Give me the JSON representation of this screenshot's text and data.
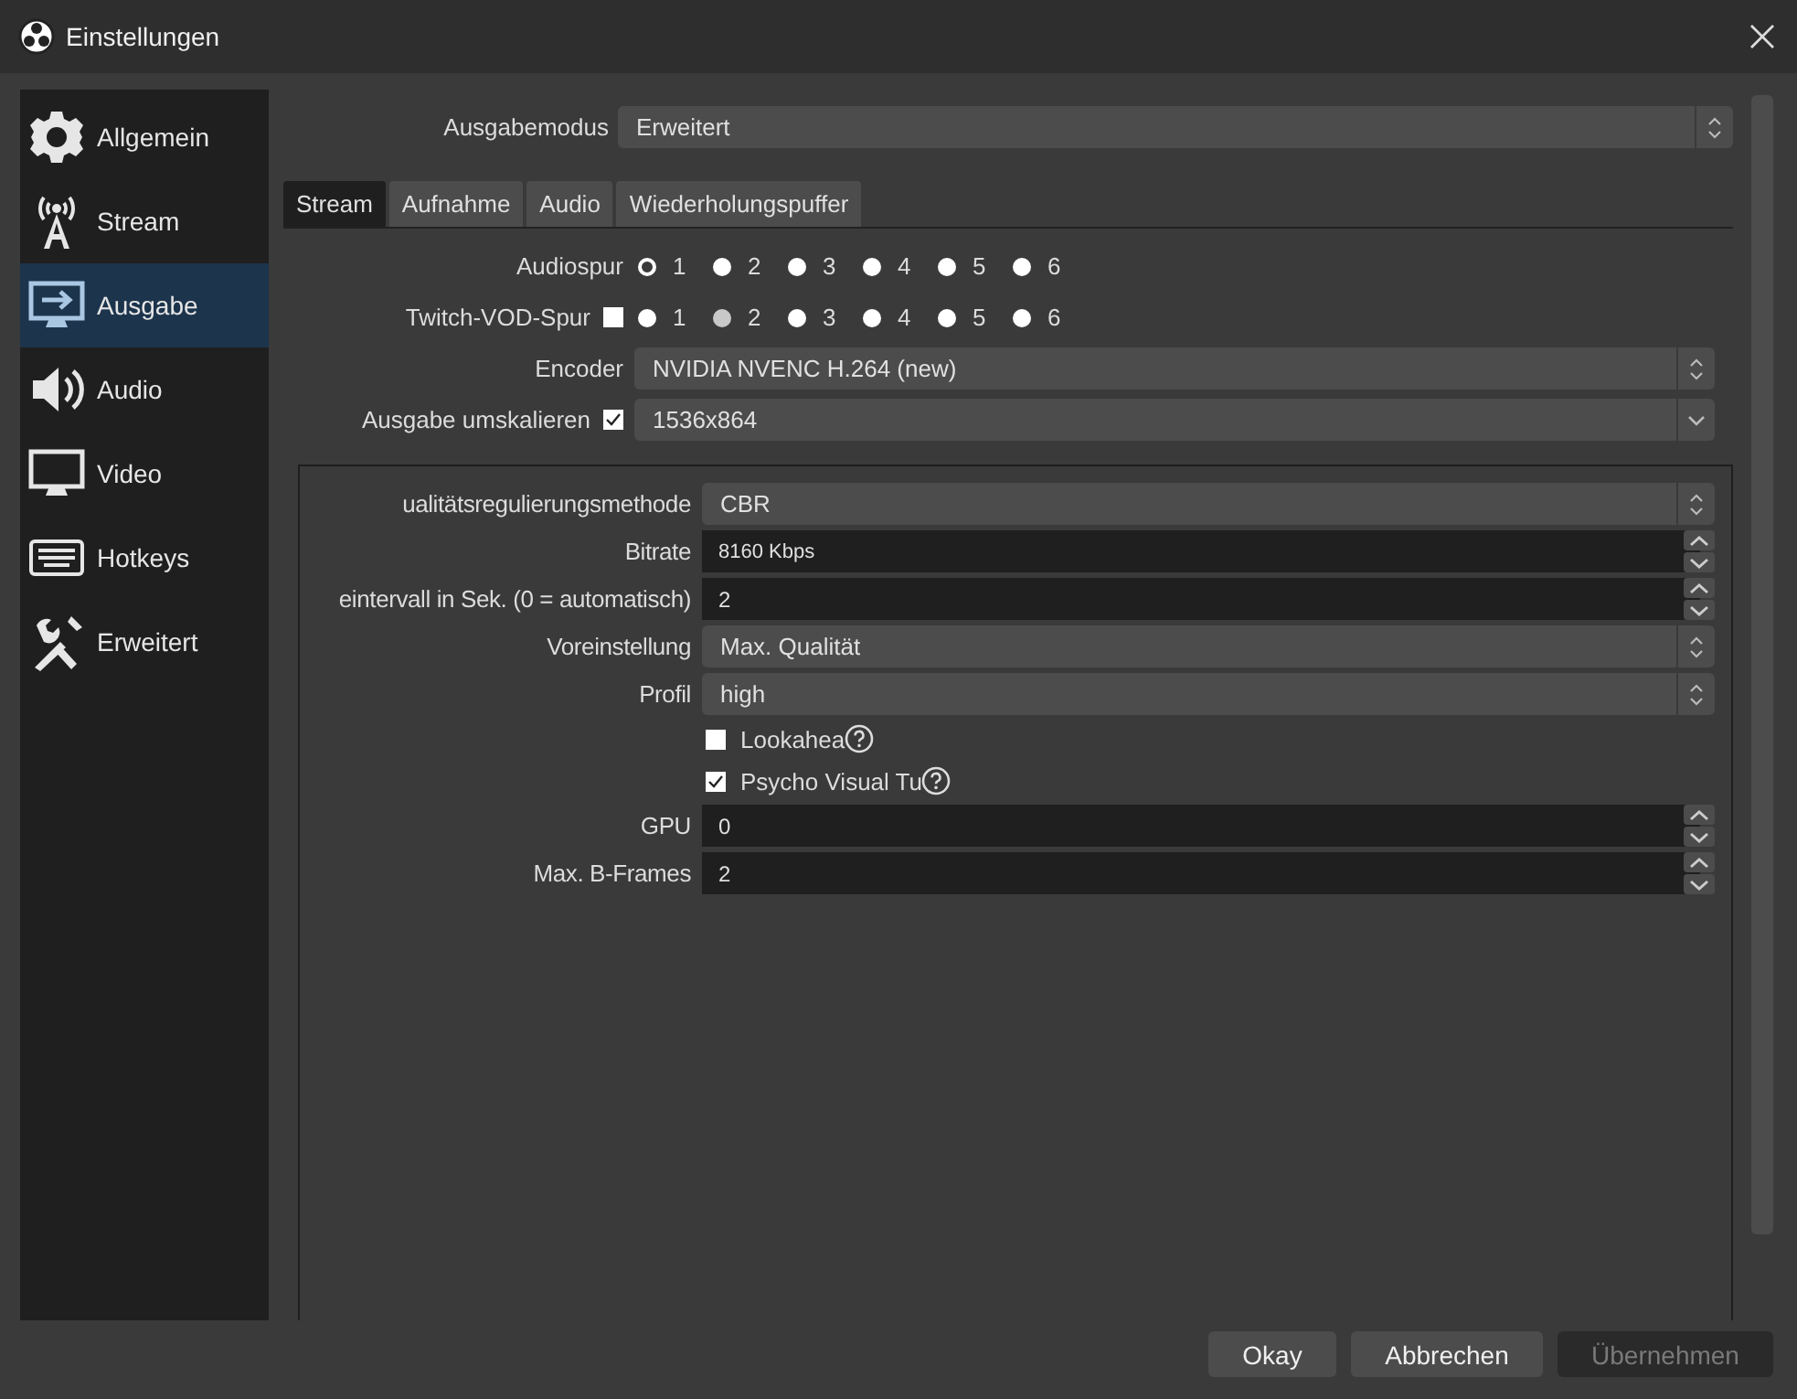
{
  "window": {
    "title": "Einstellungen"
  },
  "sidebar": {
    "items": [
      {
        "label": "Allgemein",
        "kind": "gear",
        "selected": false
      },
      {
        "label": "Stream",
        "kind": "antenna",
        "selected": false
      },
      {
        "label": "Ausgabe",
        "kind": "output",
        "selected": true
      },
      {
        "label": "Audio",
        "kind": "speaker",
        "selected": false
      },
      {
        "label": "Video",
        "kind": "monitor",
        "selected": false
      },
      {
        "label": "Hotkeys",
        "kind": "keyboard",
        "selected": false
      },
      {
        "label": "Erweitert",
        "kind": "tools",
        "selected": false
      }
    ]
  },
  "output_mode": {
    "label": "Ausgabemodus",
    "value": "Erweitert"
  },
  "tabs": [
    {
      "label": "Stream",
      "selected": true
    },
    {
      "label": "Aufnahme",
      "selected": false
    },
    {
      "label": "Audio",
      "selected": false
    },
    {
      "label": "Wiederholungspuffer",
      "selected": false
    }
  ],
  "rows": [
    {
      "kind": "radios",
      "label": "Audiospur",
      "options": [
        {
          "label": "1",
          "selected": true
        },
        {
          "label": "2",
          "selected": false
        },
        {
          "label": "3",
          "selected": false
        },
        {
          "label": "4",
          "selected": false
        },
        {
          "label": "5",
          "selected": false
        },
        {
          "label": "6",
          "selected": false
        }
      ]
    },
    {
      "kind": "check_radios",
      "label": "Twitch-VOD-Spur",
      "checked": false,
      "options": [
        {
          "label": "1",
          "selected": false
        },
        {
          "label": "2",
          "selected": true
        },
        {
          "label": "3",
          "selected": false
        },
        {
          "label": "4",
          "selected": false
        },
        {
          "label": "5",
          "selected": false
        },
        {
          "label": "6",
          "selected": false
        }
      ]
    },
    {
      "kind": "combo",
      "label": "Encoder",
      "value": "NVIDIA NVENC H.264 (new)"
    },
    {
      "kind": "check_combo",
      "label": "Ausgabe umskalieren",
      "checked": true,
      "value": "1536x864"
    }
  ],
  "encoder_settings": [
    {
      "kind": "combo",
      "label": "ualitätsregulierungsmethode",
      "value": "CBR"
    },
    {
      "kind": "spin",
      "label": "Bitrate",
      "value": "8160 Kbps"
    },
    {
      "kind": "spin",
      "label": "eintervall in Sek. (0 = automatisch)",
      "value": "2"
    },
    {
      "kind": "combo",
      "label": "Voreinstellung",
      "value": "Max. Qualität"
    },
    {
      "kind": "combo",
      "label": "Profil",
      "value": "high"
    },
    {
      "kind": "checkbox",
      "label": "Lookahea",
      "checked": false,
      "help": true
    },
    {
      "kind": "checkbox",
      "label": "Psycho Visual Tu",
      "checked": true,
      "help": true
    },
    {
      "kind": "spin",
      "label": "GPU",
      "value": "0"
    },
    {
      "kind": "spin",
      "label": "Max. B-Frames",
      "value": "2"
    }
  ],
  "buttons": [
    {
      "label": "Okay",
      "disabled": false
    },
    {
      "label": "Abbrechen",
      "disabled": false
    },
    {
      "label": "Übernehmen",
      "disabled": true
    }
  ]
}
